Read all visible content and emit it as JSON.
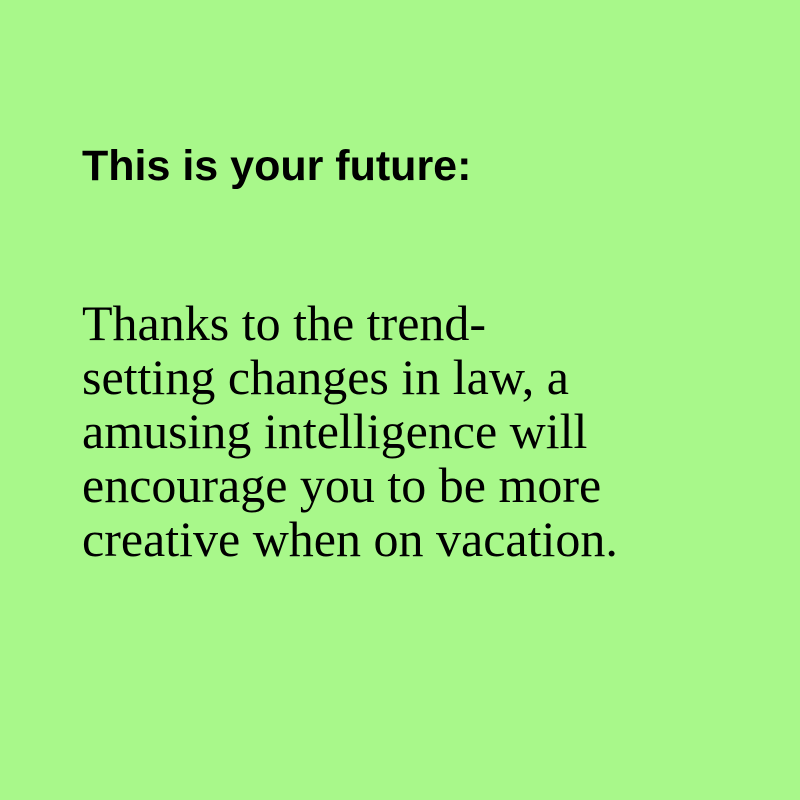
{
  "card": {
    "background": "#a8f88a",
    "heading": "This is your future:",
    "body_lines": [
      "Thanks to the trend-",
      "setting changes in law, a",
      "amusing intelligence will",
      "encourage you to be more",
      "creative when on vacation."
    ]
  }
}
